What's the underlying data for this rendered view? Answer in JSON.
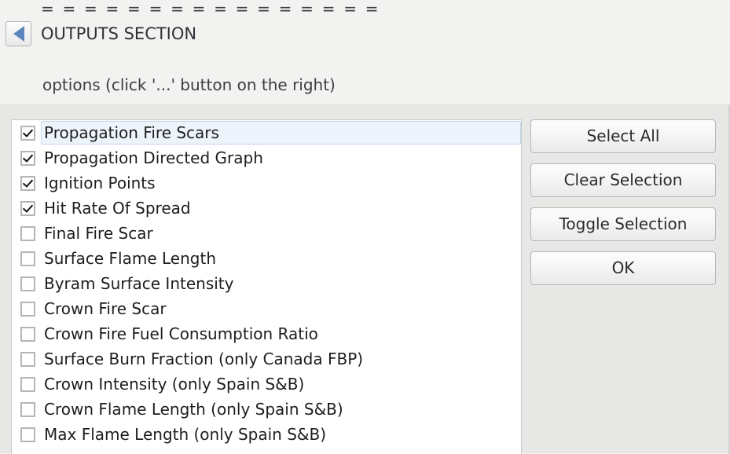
{
  "header": {
    "divider_rule": "= = = = = = = = = = = = = = = =",
    "section_title": "OUTPUTS SECTION",
    "back_icon": "triangle-left-icon",
    "subtitle": "options (click '...' button on the right)"
  },
  "colors": {
    "window_background": "#f2f2f1",
    "panel_background": "#e7e7e5",
    "list_background": "#ffffff",
    "selection_fill": "#eef4fb",
    "selection_border": "#c3d6ec",
    "back_arrow": "#5b86bd",
    "text": "#1d1d1d"
  },
  "list": {
    "name": "outputs-options-list",
    "items": [
      {
        "label": "Propagation Fire Scars",
        "checked": true,
        "selected": true
      },
      {
        "label": "Propagation Directed Graph",
        "checked": true,
        "selected": false
      },
      {
        "label": "Ignition Points",
        "checked": true,
        "selected": false
      },
      {
        "label": "Hit Rate Of Spread",
        "checked": true,
        "selected": false
      },
      {
        "label": "Final Fire Scar",
        "checked": false,
        "selected": false
      },
      {
        "label": "Surface Flame Length",
        "checked": false,
        "selected": false
      },
      {
        "label": "Byram Surface Intensity",
        "checked": false,
        "selected": false
      },
      {
        "label": "Crown Fire Scar",
        "checked": false,
        "selected": false
      },
      {
        "label": "Crown Fire Fuel Consumption Ratio",
        "checked": false,
        "selected": false
      },
      {
        "label": "Surface Burn Fraction (only Canada FBP)",
        "checked": false,
        "selected": false
      },
      {
        "label": "Crown Intensity (only Spain S&B)",
        "checked": false,
        "selected": false
      },
      {
        "label": "Crown Flame Length (only Spain S&B)",
        "checked": false,
        "selected": false
      },
      {
        "label": "Max Flame Length (only Spain S&B)",
        "checked": false,
        "selected": false
      }
    ]
  },
  "buttons": [
    {
      "label": "Select All",
      "name": "select-all-button"
    },
    {
      "label": "Clear Selection",
      "name": "clear-selection-button"
    },
    {
      "label": "Toggle Selection",
      "name": "toggle-selection-button"
    },
    {
      "label": "OK",
      "name": "ok-button"
    }
  ]
}
